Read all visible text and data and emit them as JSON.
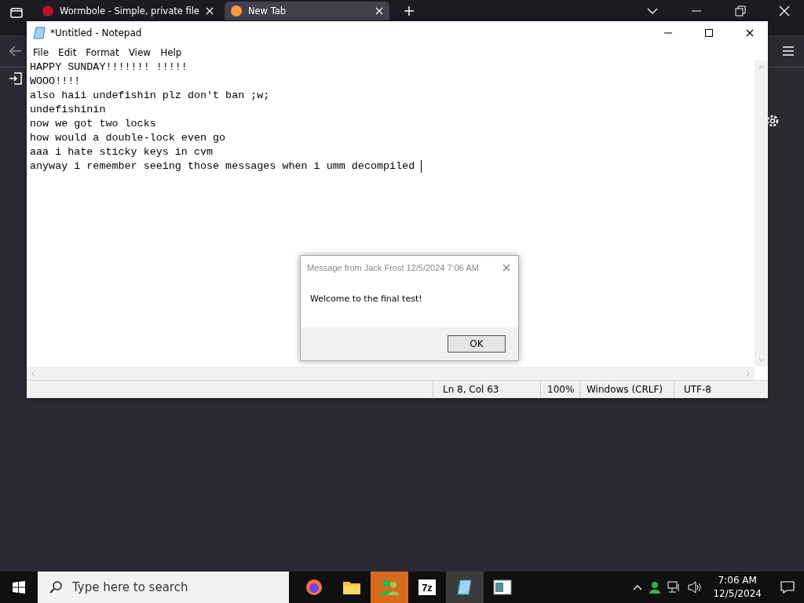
{
  "browser": {
    "tabs": [
      {
        "title": "Wormbole - Simple, private file",
        "selected": false
      },
      {
        "title": "New Tab",
        "selected": true
      }
    ]
  },
  "notepad": {
    "title": "*Untitled - Notepad",
    "menu": [
      "File",
      "Edit",
      "Format",
      "View",
      "Help"
    ],
    "lines": [
      "HAPPY SUNDAY!!!!!!! !!!!!",
      "WOOO!!!!",
      "also haii undefishin plz don't ban ;w;",
      "undefishinin",
      "now we got two locks",
      "how would a double-lock even go",
      "aaa i hate sticky keys in cvm",
      "anyway i remember seeing those messages when i umm decompiled "
    ],
    "status_bar": {
      "position": "Ln 8, Col 63",
      "zoom": "100%",
      "line_endings": "Windows (CRLF)",
      "encoding": "UTF-8"
    }
  },
  "dialog": {
    "title": "Message from Jack Frost 12/5/2024 7:06 AM",
    "message": "Welcome to the final test!",
    "buttons": [
      "OK"
    ]
  },
  "taskbar": {
    "search": {
      "placeholder": "Type here to search"
    },
    "apps": [
      {
        "kind": "firefox",
        "flashing": false,
        "focused": false
      },
      {
        "kind": "folder",
        "flashing": false,
        "focused": false
      },
      {
        "kind": "people",
        "flashing": true,
        "focused": false
      },
      {
        "kind": "archiver",
        "label": "7z",
        "flashing": false,
        "focused": false
      },
      {
        "kind": "notepad",
        "flashing": false,
        "focused": true
      },
      {
        "kind": "window",
        "flashing": false,
        "focused": false
      }
    ],
    "clock": {
      "time": "7:06 AM",
      "date": "12/5/2024"
    }
  }
}
